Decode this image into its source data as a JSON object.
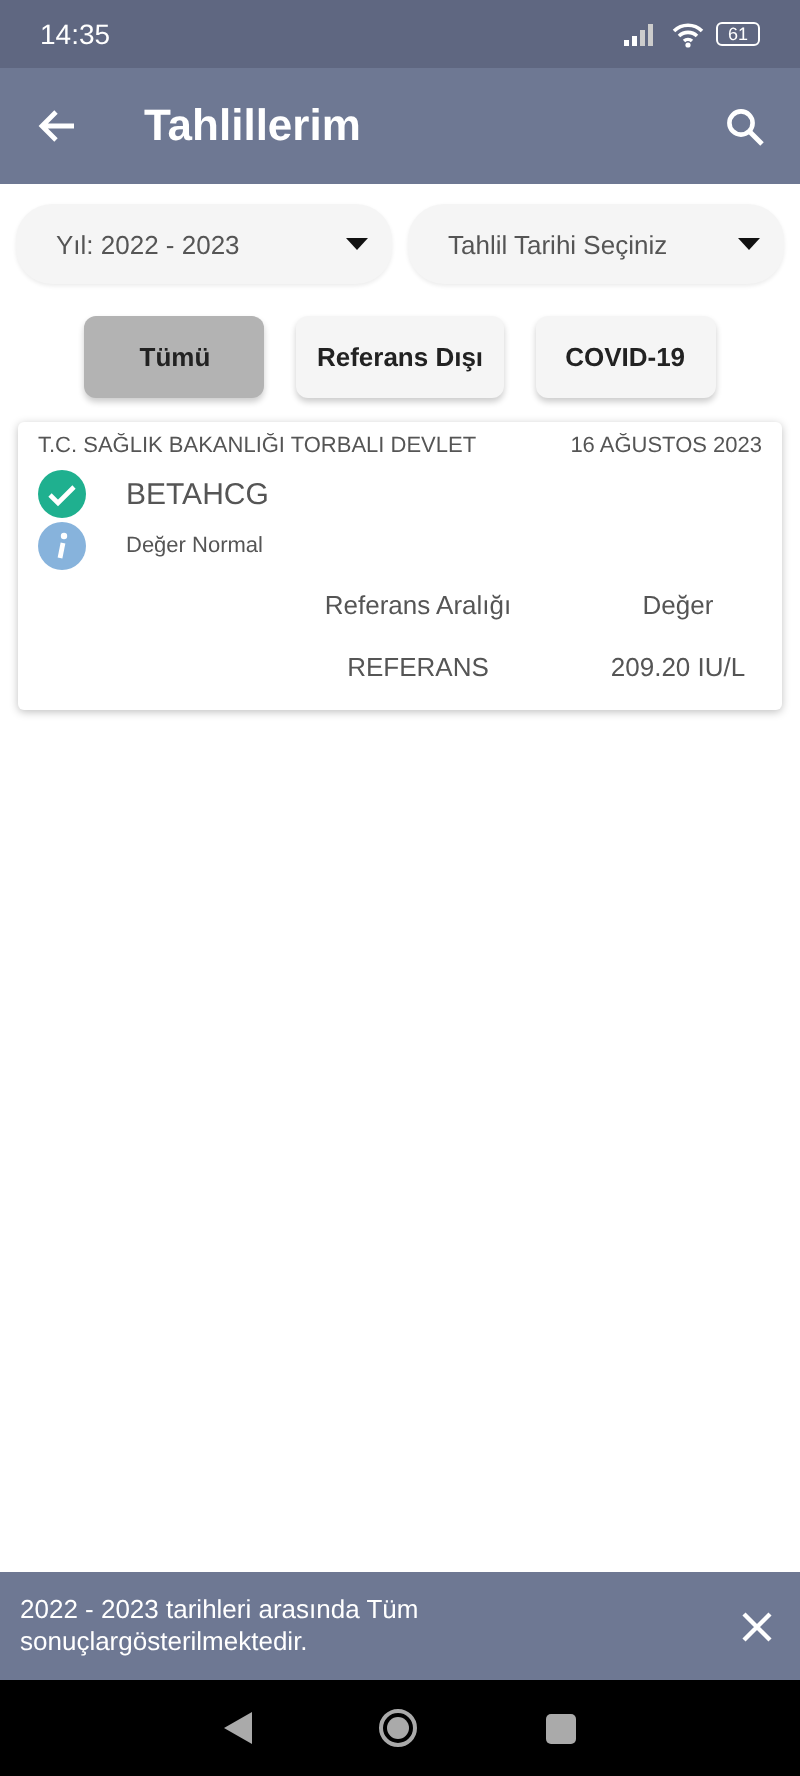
{
  "status_bar": {
    "time": "14:35",
    "battery": "61"
  },
  "app_bar": {
    "title": "Tahlillerim"
  },
  "dropdowns": [
    {
      "value": "Yıl: 2022 - 2023"
    },
    {
      "value": "Tahlil Tarihi Seçiniz"
    }
  ],
  "filters": [
    {
      "label": "Tümü",
      "selected": true
    },
    {
      "label": "Referans Dışı",
      "selected": false
    },
    {
      "label": "COVID-19",
      "selected": false
    }
  ],
  "results": [
    {
      "institution": "T.C. SAĞLIK BAKANLIĞI TORBALI DEVLET",
      "date": "16 AĞUSTOS 2023",
      "test": "BETAHCG",
      "note": "Değer Normal",
      "columns": [
        "Referans Aralığı",
        "Değer"
      ],
      "cells": [
        "REFERANS",
        "209.20 IU/L"
      ]
    }
  ],
  "snackbar": {
    "message": "2022 - 2023 tarihleri arasında Tüm sonuçlargösterilmektedir."
  }
}
